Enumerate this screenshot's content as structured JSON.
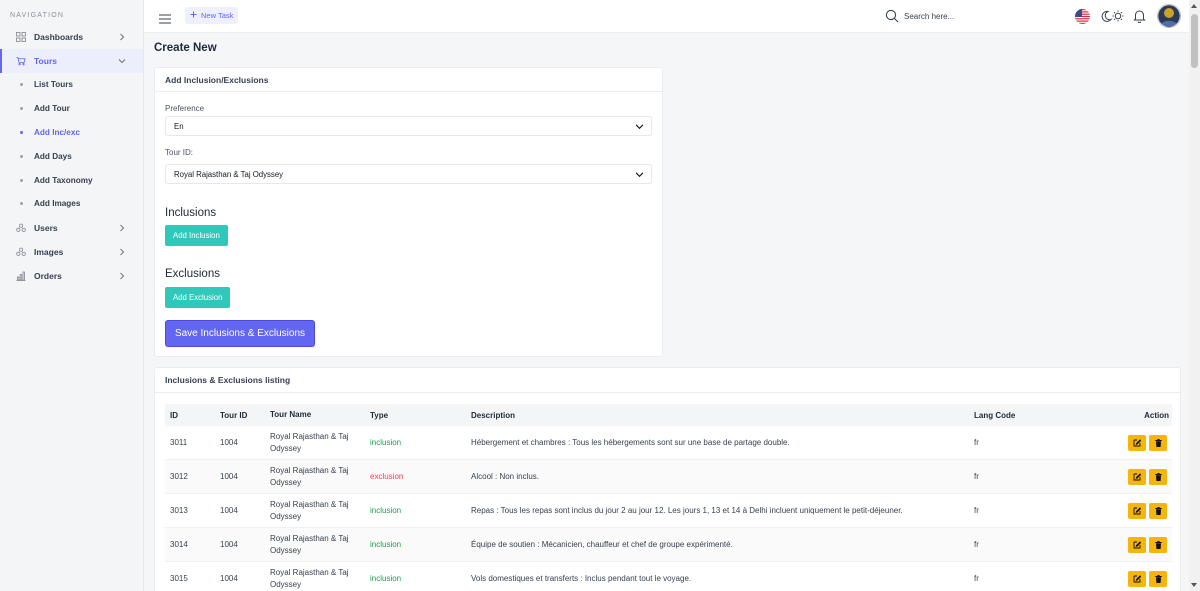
{
  "sidebar": {
    "title": "NAVIGATION",
    "items": [
      {
        "label": "Dashboards",
        "icon": "grid-icon"
      },
      {
        "label": "Tours",
        "icon": "cart-icon"
      },
      {
        "label": "Users",
        "icon": "users-icon"
      },
      {
        "label": "Images",
        "icon": "images-icon"
      },
      {
        "label": "Orders",
        "icon": "bar-chart-icon"
      }
    ],
    "tours_sub": [
      "List Tours",
      "Add Tour",
      "Add Inc/exc",
      "Add Days",
      "Add Taxonomy",
      "Add Images"
    ]
  },
  "header": {
    "new_task": "New Task",
    "search_placeholder": "Search here..."
  },
  "page": {
    "title": "Create New"
  },
  "form": {
    "card_title": "Add Inclusion/Exclusions",
    "preference_label": "Preference",
    "preference_value": "En",
    "tour_label": "Tour ID:",
    "tour_value": "Royal Rajasthan & Taj Odyssey",
    "inclusions_heading": "Inclusions",
    "add_inclusion": "Add Inclusion",
    "exclusions_heading": "Exclusions",
    "add_exclusion": "Add Exclusion",
    "save": "Save Inclusions & Exclusions"
  },
  "listing": {
    "card_title": "Inclusions & Exclusions listing",
    "columns": [
      "ID",
      "Tour ID",
      "Tour Name",
      "Type",
      "Description",
      "Lang Code",
      "Action"
    ],
    "rows": [
      {
        "id": "3011",
        "tour_id": "1004",
        "tour_name": "Royal Rajasthan & Taj Odyssey",
        "type": "inclusion",
        "description": "Hébergement et chambres : Tous les hébergements sont sur une base de partage double.",
        "lang": "fr"
      },
      {
        "id": "3012",
        "tour_id": "1004",
        "tour_name": "Royal Rajasthan & Taj Odyssey",
        "type": "exclusion",
        "description": "Alcool : Non inclus.",
        "lang": "fr"
      },
      {
        "id": "3013",
        "tour_id": "1004",
        "tour_name": "Royal Rajasthan & Taj Odyssey",
        "type": "inclusion",
        "description": "Repas : Tous les repas sont inclus du jour 2 au jour 12. Les jours 1, 13 et 14 à Delhi incluent uniquement le petit-déjeuner.",
        "lang": "fr"
      },
      {
        "id": "3014",
        "tour_id": "1004",
        "tour_name": "Royal Rajasthan & Taj Odyssey",
        "type": "inclusion",
        "description": "Équipe de soutien : Mécanicien, chauffeur et chef de groupe expérimenté.",
        "lang": "fr"
      },
      {
        "id": "3015",
        "tour_id": "1004",
        "tour_name": "Royal Rajasthan & Taj Odyssey",
        "type": "inclusion",
        "description": "Vols domestiques et transferts : Inclus pendant tout le voyage.",
        "lang": "fr"
      }
    ]
  },
  "colors": {
    "accent": "#6366f1",
    "teal": "#2fc8bb",
    "inclusion": "#16a34a",
    "exclusion": "#ef4444",
    "action": "#f5b50a"
  }
}
